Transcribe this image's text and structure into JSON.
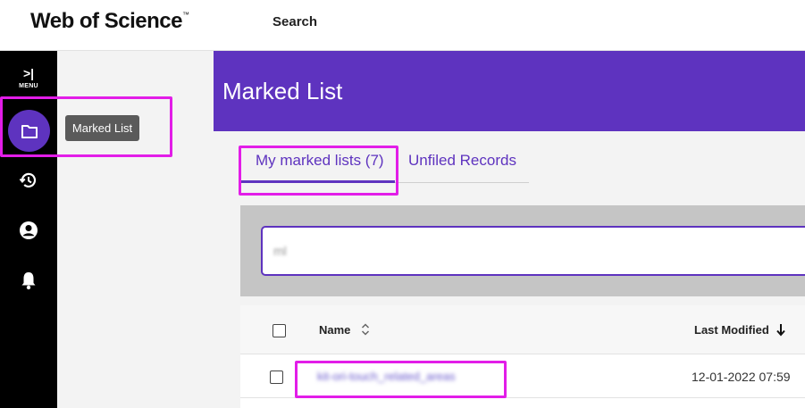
{
  "header": {
    "logo_text": "Web of Science",
    "logo_tm": "™",
    "nav_search": "Search"
  },
  "rail": {
    "menu_glyph": ">|",
    "menu_label": "MENU",
    "items": [
      {
        "icon": "folder-icon",
        "active": true
      },
      {
        "icon": "history-icon"
      },
      {
        "icon": "account-icon"
      },
      {
        "icon": "bell-icon"
      }
    ],
    "tooltip": "Marked List"
  },
  "page": {
    "title": "Marked List"
  },
  "tabs": [
    {
      "label": "My marked lists (7)",
      "active": true
    },
    {
      "label": "Unfiled Records",
      "active": false
    }
  ],
  "search": {
    "value": "ml"
  },
  "table": {
    "columns": {
      "name": "Name",
      "last_modified": "Last Modified"
    },
    "rows": [
      {
        "name": "kit-ori-touch_related_areas",
        "last_modified": "12-01-2022 07:59"
      }
    ]
  },
  "colors": {
    "accent": "#5e33bf",
    "highlight": "#e21de8",
    "rail": "#000000"
  }
}
